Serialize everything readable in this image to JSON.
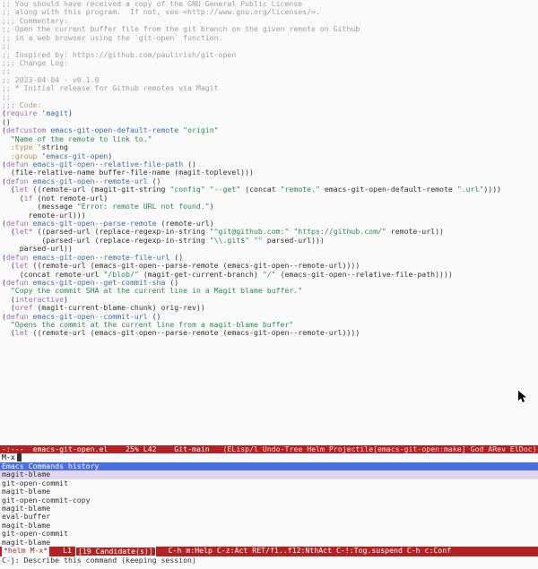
{
  "code_lines": [
    {
      "segs": [
        {
          "cls": "c",
          "t": ";; You should have received a copy of the GNU General Public License"
        }
      ]
    },
    {
      "segs": [
        {
          "cls": "c",
          "t": ";; along with this program.  If not, see <http://www.gnu.org/licenses/>."
        }
      ]
    },
    {
      "segs": [
        {
          "cls": "p",
          "t": ""
        }
      ]
    },
    {
      "segs": [
        {
          "cls": "c",
          "t": ";;; Commentary:"
        }
      ]
    },
    {
      "segs": [
        {
          "cls": "p",
          "t": ""
        }
      ]
    },
    {
      "segs": [
        {
          "cls": "c",
          "t": ";; Open the current buffer file from the git branch on the given remote on Github"
        }
      ]
    },
    {
      "segs": [
        {
          "cls": "c",
          "t": ";; in a web browser using the `git-open` function."
        }
      ]
    },
    {
      "segs": [
        {
          "cls": "c",
          "t": ";;"
        }
      ]
    },
    {
      "segs": [
        {
          "cls": "c",
          "t": ";; Inspired by: https://github.com/paulirish/git-open"
        }
      ]
    },
    {
      "segs": [
        {
          "cls": "p",
          "t": ""
        }
      ]
    },
    {
      "segs": [
        {
          "cls": "c",
          "t": ";;; Change Log:"
        }
      ]
    },
    {
      "segs": [
        {
          "cls": "c",
          "t": ";;"
        }
      ]
    },
    {
      "segs": [
        {
          "cls": "c",
          "t": ";; 2023-04-04 - v0.1.0"
        }
      ]
    },
    {
      "segs": [
        {
          "cls": "c",
          "t": ";; * Initial release for Github remotes via Magit"
        }
      ]
    },
    {
      "segs": [
        {
          "cls": "c",
          "t": ";;"
        }
      ]
    },
    {
      "segs": [
        {
          "cls": "p",
          "t": ""
        }
      ]
    },
    {
      "segs": [
        {
          "cls": "c",
          "t": ";;; Code:"
        }
      ]
    },
    {
      "segs": [
        {
          "cls": "p",
          "t": "("
        },
        {
          "cls": "kw",
          "t": "require"
        },
        {
          "cls": "p",
          "t": " '"
        },
        {
          "cls": "fn",
          "t": "magit"
        },
        {
          "cls": "p",
          "t": ")"
        }
      ]
    },
    {
      "segs": [
        {
          "cls": "p",
          "t": "()"
        }
      ]
    },
    {
      "segs": [
        {
          "cls": "p",
          "t": "("
        },
        {
          "cls": "kw",
          "t": "defcustom"
        },
        {
          "cls": "p",
          "t": " "
        },
        {
          "cls": "fn",
          "t": "emacs-git-open-default-remote"
        },
        {
          "cls": "p",
          "t": " "
        },
        {
          "cls": "s",
          "t": "\"origin\""
        }
      ]
    },
    {
      "segs": [
        {
          "cls": "p",
          "t": "  "
        },
        {
          "cls": "s",
          "t": "\"Name of the remote to link to.\""
        }
      ]
    },
    {
      "segs": [
        {
          "cls": "p",
          "t": "  "
        },
        {
          "cls": "t",
          "t": ":type"
        },
        {
          "cls": "p",
          "t": " 'string"
        }
      ]
    },
    {
      "segs": [
        {
          "cls": "p",
          "t": "  "
        },
        {
          "cls": "t",
          "t": ":group"
        },
        {
          "cls": "p",
          "t": " '"
        },
        {
          "cls": "fn",
          "t": "emacs-git-open"
        },
        {
          "cls": "p",
          "t": ")"
        }
      ]
    },
    {
      "segs": [
        {
          "cls": "p",
          "t": ""
        }
      ]
    },
    {
      "segs": [
        {
          "cls": "p",
          "t": "("
        },
        {
          "cls": "kw",
          "t": "defun"
        },
        {
          "cls": "p",
          "t": " "
        },
        {
          "cls": "fn",
          "t": "emacs-git-open--relative-file-path"
        },
        {
          "cls": "p",
          "t": " ()"
        }
      ]
    },
    {
      "segs": [
        {
          "cls": "p",
          "t": "  (file-relative-name buffer-file-name (magit-toplevel)))"
        }
      ]
    },
    {
      "segs": [
        {
          "cls": "p",
          "t": ""
        }
      ]
    },
    {
      "segs": [
        {
          "cls": "p",
          "t": "("
        },
        {
          "cls": "kw",
          "t": "defun"
        },
        {
          "cls": "p",
          "t": " "
        },
        {
          "cls": "fn",
          "t": "emacs-git-open--remote-url"
        },
        {
          "cls": "p",
          "t": " ()"
        }
      ]
    },
    {
      "segs": [
        {
          "cls": "p",
          "t": "  ("
        },
        {
          "cls": "kw",
          "t": "let"
        },
        {
          "cls": "p",
          "t": " ((remote-url (magit-git-string "
        },
        {
          "cls": "s",
          "t": "\"config\""
        },
        {
          "cls": "p",
          "t": " "
        },
        {
          "cls": "s",
          "t": "\"--get\""
        },
        {
          "cls": "p",
          "t": " (concat "
        },
        {
          "cls": "s",
          "t": "\"remote.\""
        },
        {
          "cls": "p",
          "t": " emacs-git-open-default-remote "
        },
        {
          "cls": "s",
          "t": "\".url\""
        },
        {
          "cls": "p",
          "t": "))))"
        }
      ]
    },
    {
      "segs": [
        {
          "cls": "p",
          "t": "    ("
        },
        {
          "cls": "kw",
          "t": "if"
        },
        {
          "cls": "p",
          "t": " (not remote-url)"
        }
      ]
    },
    {
      "segs": [
        {
          "cls": "p",
          "t": "        (message "
        },
        {
          "cls": "s",
          "t": "\"Error: remote URL not found.\""
        },
        {
          "cls": "p",
          "t": ")"
        }
      ]
    },
    {
      "segs": [
        {
          "cls": "p",
          "t": "      remote-url)))"
        }
      ]
    },
    {
      "segs": [
        {
          "cls": "p",
          "t": ""
        }
      ]
    },
    {
      "segs": [
        {
          "cls": "p",
          "t": "("
        },
        {
          "cls": "kw",
          "t": "defun"
        },
        {
          "cls": "p",
          "t": " "
        },
        {
          "cls": "fn",
          "t": "emacs-git-open--parse-remote"
        },
        {
          "cls": "p",
          "t": " (remote-url)"
        }
      ]
    },
    {
      "segs": [
        {
          "cls": "p",
          "t": "  ("
        },
        {
          "cls": "kw",
          "t": "let*"
        },
        {
          "cls": "p",
          "t": " ((parsed-url (replace-regexp-in-string "
        },
        {
          "cls": "s",
          "t": "\"^git@github.com:\" \"https://github.com/\""
        },
        {
          "cls": "p",
          "t": " remote-url))"
        }
      ]
    },
    {
      "segs": [
        {
          "cls": "p",
          "t": "         (parsed-url (replace-regexp-in-string "
        },
        {
          "cls": "s",
          "t": "\"\\\\.git$\" \"\""
        },
        {
          "cls": "p",
          "t": " parsed-url)))"
        }
      ]
    },
    {
      "segs": [
        {
          "cls": "p",
          "t": "    parsed-url))"
        }
      ]
    },
    {
      "segs": [
        {
          "cls": "p",
          "t": ""
        }
      ]
    },
    {
      "segs": [
        {
          "cls": "p",
          "t": "("
        },
        {
          "cls": "kw",
          "t": "defun"
        },
        {
          "cls": "p",
          "t": " "
        },
        {
          "cls": "fn",
          "t": "emacs-git-open--remote-file-url"
        },
        {
          "cls": "p",
          "t": " ()"
        }
      ]
    },
    {
      "segs": [
        {
          "cls": "p",
          "t": "  ("
        },
        {
          "cls": "kw",
          "t": "let"
        },
        {
          "cls": "p",
          "t": " ((remote-url (emacs-git-open--parse-remote (emacs-git-open--remote-url))))"
        }
      ]
    },
    {
      "segs": [
        {
          "cls": "p",
          "t": "    (concat remote-url "
        },
        {
          "cls": "s",
          "t": "\"/blob/\""
        },
        {
          "cls": "p",
          "t": " (magit-get-current-branch) "
        },
        {
          "cls": "s",
          "t": "\"/\""
        },
        {
          "cls": "p",
          "t": " (emacs-git-open--relative-file-path))))"
        }
      ]
    },
    {
      "segs": [
        {
          "cls": "p",
          "t": ""
        }
      ]
    },
    {
      "segs": [
        {
          "cls": "p",
          "t": "("
        },
        {
          "cls": "kw",
          "t": "defun"
        },
        {
          "cls": "p",
          "t": " "
        },
        {
          "cls": "fn",
          "t": "emacs-git-open--get-commit-sha"
        },
        {
          "cls": "p",
          "t": " ()"
        }
      ]
    },
    {
      "segs": [
        {
          "cls": "p",
          "t": "  "
        },
        {
          "cls": "s",
          "t": "\"Copy the commit SHA at the current line in a Magit blame buffer.\""
        }
      ]
    },
    {
      "segs": [
        {
          "cls": "p",
          "t": "  ("
        },
        {
          "cls": "kw",
          "t": "interactive"
        },
        {
          "cls": "p",
          "t": ")"
        }
      ]
    },
    {
      "segs": [
        {
          "cls": "p",
          "t": "  ("
        },
        {
          "cls": "kw",
          "t": "oref"
        },
        {
          "cls": "p",
          "t": " (magit-current-blame-chunk) orig-rev))"
        }
      ]
    },
    {
      "segs": [
        {
          "cls": "p",
          "t": ""
        }
      ]
    },
    {
      "segs": [
        {
          "cls": "p",
          "t": "("
        },
        {
          "cls": "kw",
          "t": "defun"
        },
        {
          "cls": "p",
          "t": " "
        },
        {
          "cls": "fn",
          "t": "emacs-git-open--commit-url"
        },
        {
          "cls": "p",
          "t": " ()"
        }
      ]
    },
    {
      "segs": [
        {
          "cls": "p",
          "t": "  "
        },
        {
          "cls": "s",
          "t": "\"Opens the commit at the current line from a magit-blame buffer\""
        }
      ]
    },
    {
      "segs": [
        {
          "cls": "p",
          "t": "  ("
        },
        {
          "cls": "kw",
          "t": "let"
        },
        {
          "cls": "p",
          "t": " ((remote-url (emacs-git-open--parse-remote (emacs-git-open--remote-url))))"
        }
      ]
    }
  ],
  "modeline_main": {
    "left": "-:---",
    "buffer": "emacs-git-open.el",
    "pct": "25%",
    "pos": "L42",
    "branch": "Git-main",
    "modes": "(ELisp/l Undo-Tree Helm Projectile[emacs-git-open:make] God ARev ElDoc)"
  },
  "minibuffer": {
    "prompt": "M-x "
  },
  "helm": {
    "header": "Emacs Commands history",
    "candidates": [
      "magit-blame",
      "git-open-commit",
      "magit-blame",
      "git-open-commit-copy",
      "magit-blame",
      "eval-buffer",
      "magit-blame",
      "git-open-commit",
      "magit-blame"
    ],
    "selected_index": 0,
    "modeline": {
      "source": "*helm M-x*",
      "pos": "L1",
      "count": "[19 Candidate(s)]",
      "help": "C-h m:Help C-z:Act RET/f1..f12:NthAct C-!:Tog.suspend C-h c:Conf"
    }
  },
  "echo": "C-j: Describe this command (keeping session)"
}
